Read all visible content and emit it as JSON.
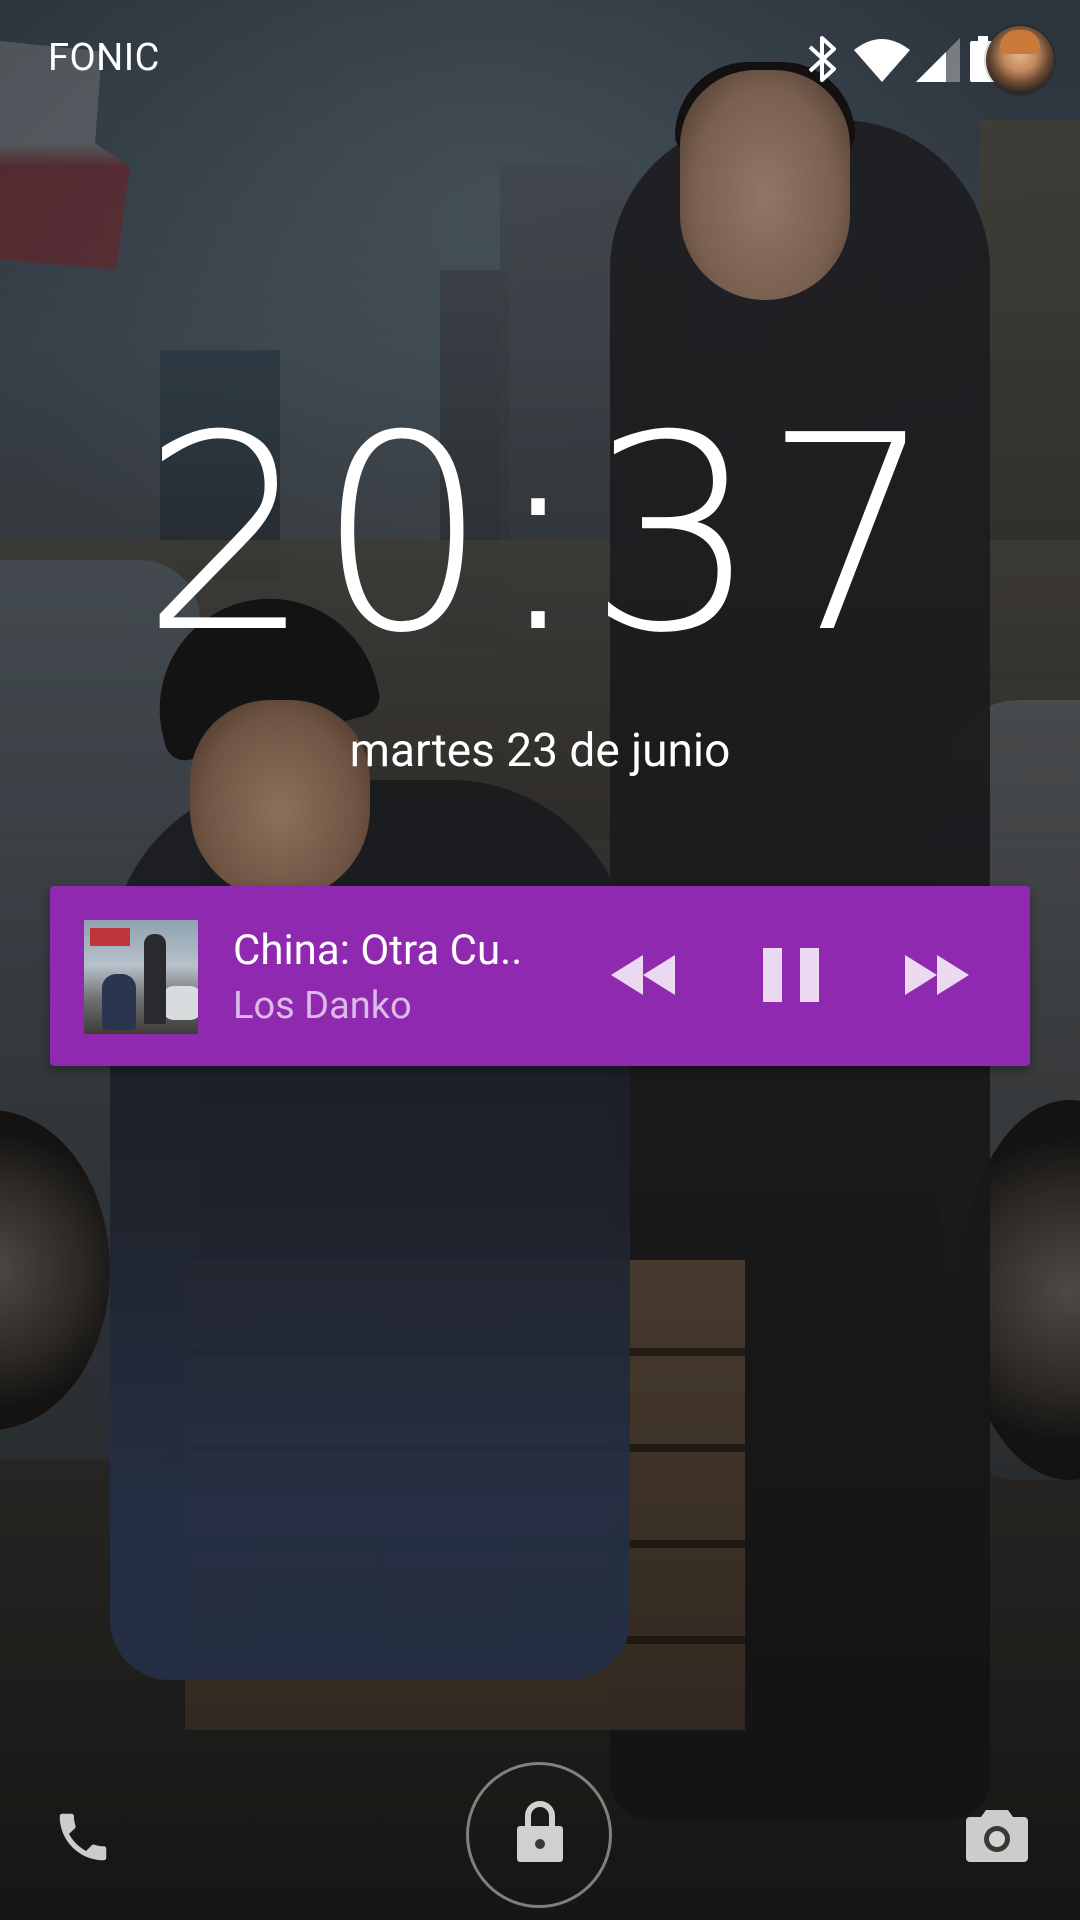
{
  "status_bar": {
    "carrier": "FONIC",
    "icons": [
      "bluetooth-icon",
      "wifi-icon",
      "cell-signal-icon",
      "battery-icon"
    ],
    "avatar": "user-avatar"
  },
  "lockscreen": {
    "time": "20:37",
    "date": "martes 23 de junio"
  },
  "media_notification": {
    "background_color": "#8f2ab0",
    "title": "China: Otra Cu..",
    "artist": "Los Danko",
    "controls": [
      "rewind-icon",
      "pause-icon",
      "fast-forward-icon"
    ]
  },
  "bottom_bar": {
    "left_shortcut": "phone-icon",
    "center": "lock-icon",
    "right_shortcut": "camera-icon"
  }
}
